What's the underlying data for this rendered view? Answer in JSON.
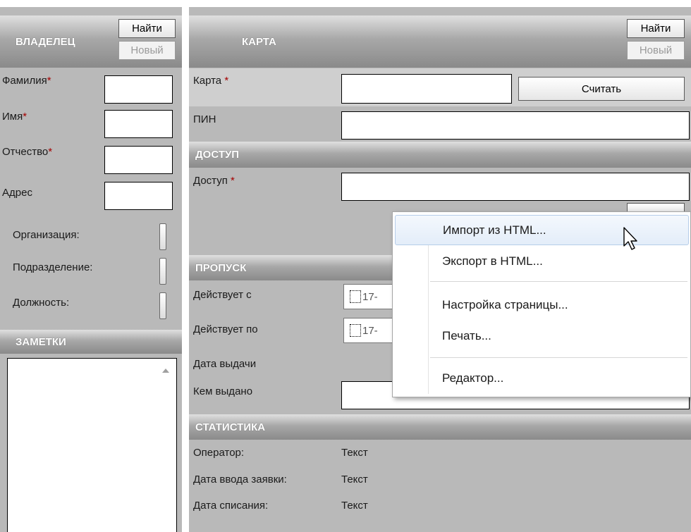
{
  "owner": {
    "header": "ВЛАДЕЛЕЦ",
    "find_button": "Найти",
    "new_button": "Новый",
    "fields": [
      {
        "label": "Фамилия",
        "required": "*"
      },
      {
        "label": "Имя",
        "required": "*"
      },
      {
        "label": "Отчество",
        "required": "*"
      },
      {
        "label": "Адрес",
        "required": ""
      }
    ],
    "org_label": "Организация:",
    "dept_label": "Подразделение:",
    "position_label": "Должность:"
  },
  "notes": {
    "header": "ЗАМЕТКИ"
  },
  "card": {
    "header": "КАРТА",
    "find_button": "Найти",
    "new_button": "Новый",
    "card_label": "Карта ",
    "card_required": "*",
    "read_button": "Считать",
    "pin_label": "ПИН"
  },
  "access": {
    "header": "ДОСТУП",
    "access_label": "Доступ ",
    "access_required": "*"
  },
  "pass": {
    "header": "ПРОПУСК",
    "valid_from_label": "Действует с",
    "valid_from_value": "17-",
    "valid_to_label": "Действует по",
    "valid_to_value": "17-",
    "issue_date_label": "Дата выдачи",
    "issued_by_label": "Кем выдано"
  },
  "stats": {
    "header": "СТАТИСТИКА",
    "rows": [
      {
        "label": "Оператор:",
        "value": "Текст"
      },
      {
        "label": "Дата ввода заявки:",
        "value": "Текст"
      },
      {
        "label": "Дата списания:",
        "value": "Текст"
      }
    ]
  },
  "context_menu": {
    "items": [
      "Импорт из HTML...",
      "Экспорт в HTML...",
      "Настройка страницы...",
      "Печать...",
      "Редактор..."
    ]
  }
}
